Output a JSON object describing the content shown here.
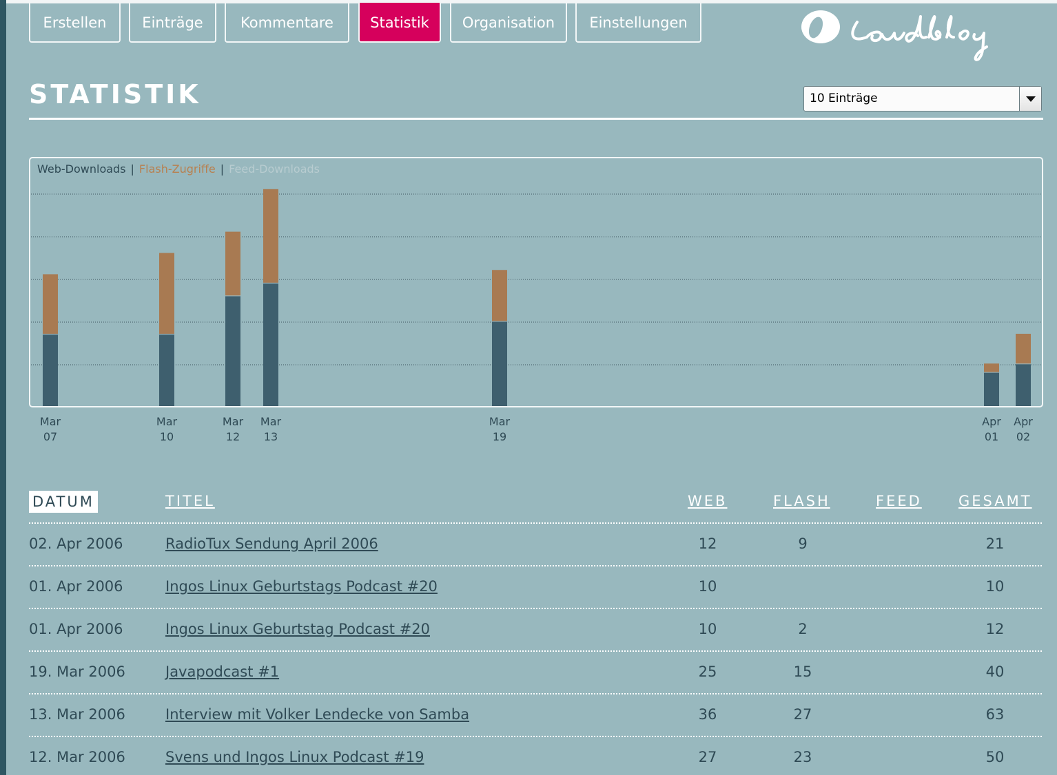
{
  "nav": {
    "tabs": [
      {
        "label": "Erstellen"
      },
      {
        "label": "Einträge"
      },
      {
        "label": "Kommentare"
      },
      {
        "label": "Statistik",
        "active": true
      },
      {
        "label": "Organisation"
      },
      {
        "label": "Einstellungen"
      }
    ]
  },
  "logo": {
    "text": "Loudblog",
    "icon": "loudblog-logo-icon"
  },
  "page": {
    "title": "STATISTIK"
  },
  "filter": {
    "selected": "10 Einträge"
  },
  "legend": {
    "web": "Web-Downloads",
    "flash": "Flash-Zugriffe",
    "feed": "Feed-Downloads",
    "separator": "|"
  },
  "colors": {
    "web": "#3e5f6e",
    "flash": "#a87a52",
    "feed": "#b8ccd0",
    "active_tab": "#d6005c",
    "background": "#98b8be"
  },
  "chart_data": {
    "type": "bar",
    "stacked": true,
    "categories": [
      "Mar 07",
      "Mar 10",
      "Mar 12",
      "Mar 13",
      "Mar 19",
      "Apr 01",
      "Apr 02"
    ],
    "series": [
      {
        "name": "Web-Downloads",
        "values": [
          17,
          17,
          26,
          29,
          20,
          8,
          10
        ]
      },
      {
        "name": "Flash-Zugriffe",
        "values": [
          14,
          19,
          15,
          22,
          12,
          2,
          7
        ]
      },
      {
        "name": "Feed-Downloads",
        "values": [
          0,
          0,
          0,
          0,
          0,
          0,
          0
        ]
      }
    ],
    "grid": true,
    "legend_position": "top-left"
  },
  "table": {
    "headers": {
      "datum": "DATUM",
      "titel": "TITEL",
      "web": "WEB",
      "flash": "FLASH",
      "feed": "FEED",
      "gesamt": "GESAMT"
    },
    "rows": [
      {
        "date": "02. Apr 2006",
        "title": "RadioTux Sendung April 2006",
        "web": "12",
        "flash": "9",
        "feed": "",
        "total": "21"
      },
      {
        "date": "01. Apr 2006",
        "title": "Ingos Linux Geburtstags Podcast #20",
        "web": "10",
        "flash": "",
        "feed": "",
        "total": "10"
      },
      {
        "date": "01. Apr 2006",
        "title": "Ingos Linux Geburtstag Podcast #20",
        "web": "10",
        "flash": "2",
        "feed": "",
        "total": "12"
      },
      {
        "date": "19. Mar 2006",
        "title": "Javapodcast #1",
        "web": "25",
        "flash": "15",
        "feed": "",
        "total": "40"
      },
      {
        "date": "13. Mar 2006",
        "title": "Interview mit Volker Lendecke von Samba",
        "web": "36",
        "flash": "27",
        "feed": "",
        "total": "63"
      },
      {
        "date": "12. Mar 2006",
        "title": "Svens und Ingos Linux Podcast #19",
        "web": "27",
        "flash": "23",
        "feed": "",
        "total": "50"
      }
    ]
  }
}
